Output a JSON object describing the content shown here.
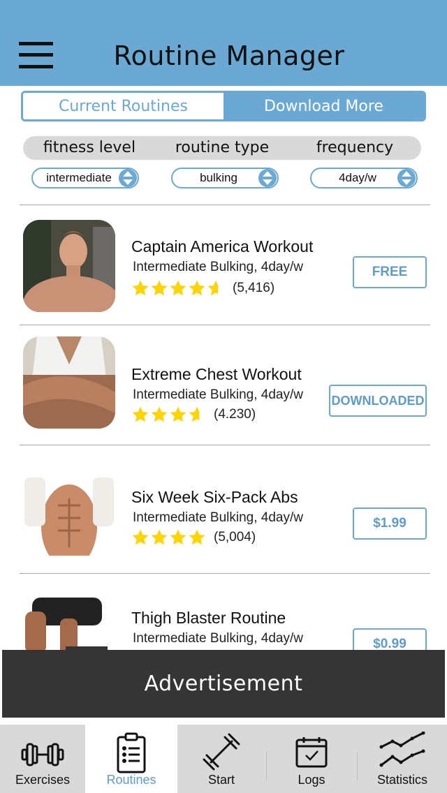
{
  "header": {
    "title": "Routine Manager"
  },
  "segments": {
    "current": "Current Routines",
    "download": "Download More"
  },
  "filters": {
    "fitness_level": {
      "label": "fitness level",
      "value": "intermediate"
    },
    "routine_type": {
      "label": "routine type",
      "value": "bulking"
    },
    "frequency": {
      "label": "frequency",
      "value": "4day/w"
    }
  },
  "routines": [
    {
      "title": "Captain America Workout",
      "subtitle": "Intermediate Bulking, 4day/w",
      "rating": 4.5,
      "reviews": "(5,416)",
      "price": "FREE"
    },
    {
      "title": "Extreme Chest Workout",
      "subtitle": "Intermediate Bulking, 4day/w",
      "rating": 3.5,
      "reviews": "(4.230)",
      "price": "DOWNLOADED"
    },
    {
      "title": "Six Week Six-Pack Abs",
      "subtitle": "Intermediate Bulking, 4day/w",
      "rating": 4,
      "reviews": "(5,004)",
      "price": "$1.99"
    },
    {
      "title": "Thigh Blaster Routine",
      "subtitle": "Intermediate Bulking, 4day/w",
      "rating": null,
      "reviews": "",
      "price": "$0.99"
    }
  ],
  "advertisement": {
    "label": "Advertisement"
  },
  "tabs": [
    {
      "label": "Exercises",
      "icon": "dumbbell-icon"
    },
    {
      "label": "Routines",
      "icon": "clipboard-list-icon",
      "active": true
    },
    {
      "label": "Start",
      "icon": "barbell-icon"
    },
    {
      "label": "Logs",
      "icon": "calendar-check-icon"
    },
    {
      "label": "Statistics",
      "icon": "line-chart-icon"
    }
  ],
  "colors": {
    "accent": "#6aa9d3",
    "star": "#ffd400",
    "ad_background": "#353535",
    "tabbar": "#d9d9d9"
  }
}
